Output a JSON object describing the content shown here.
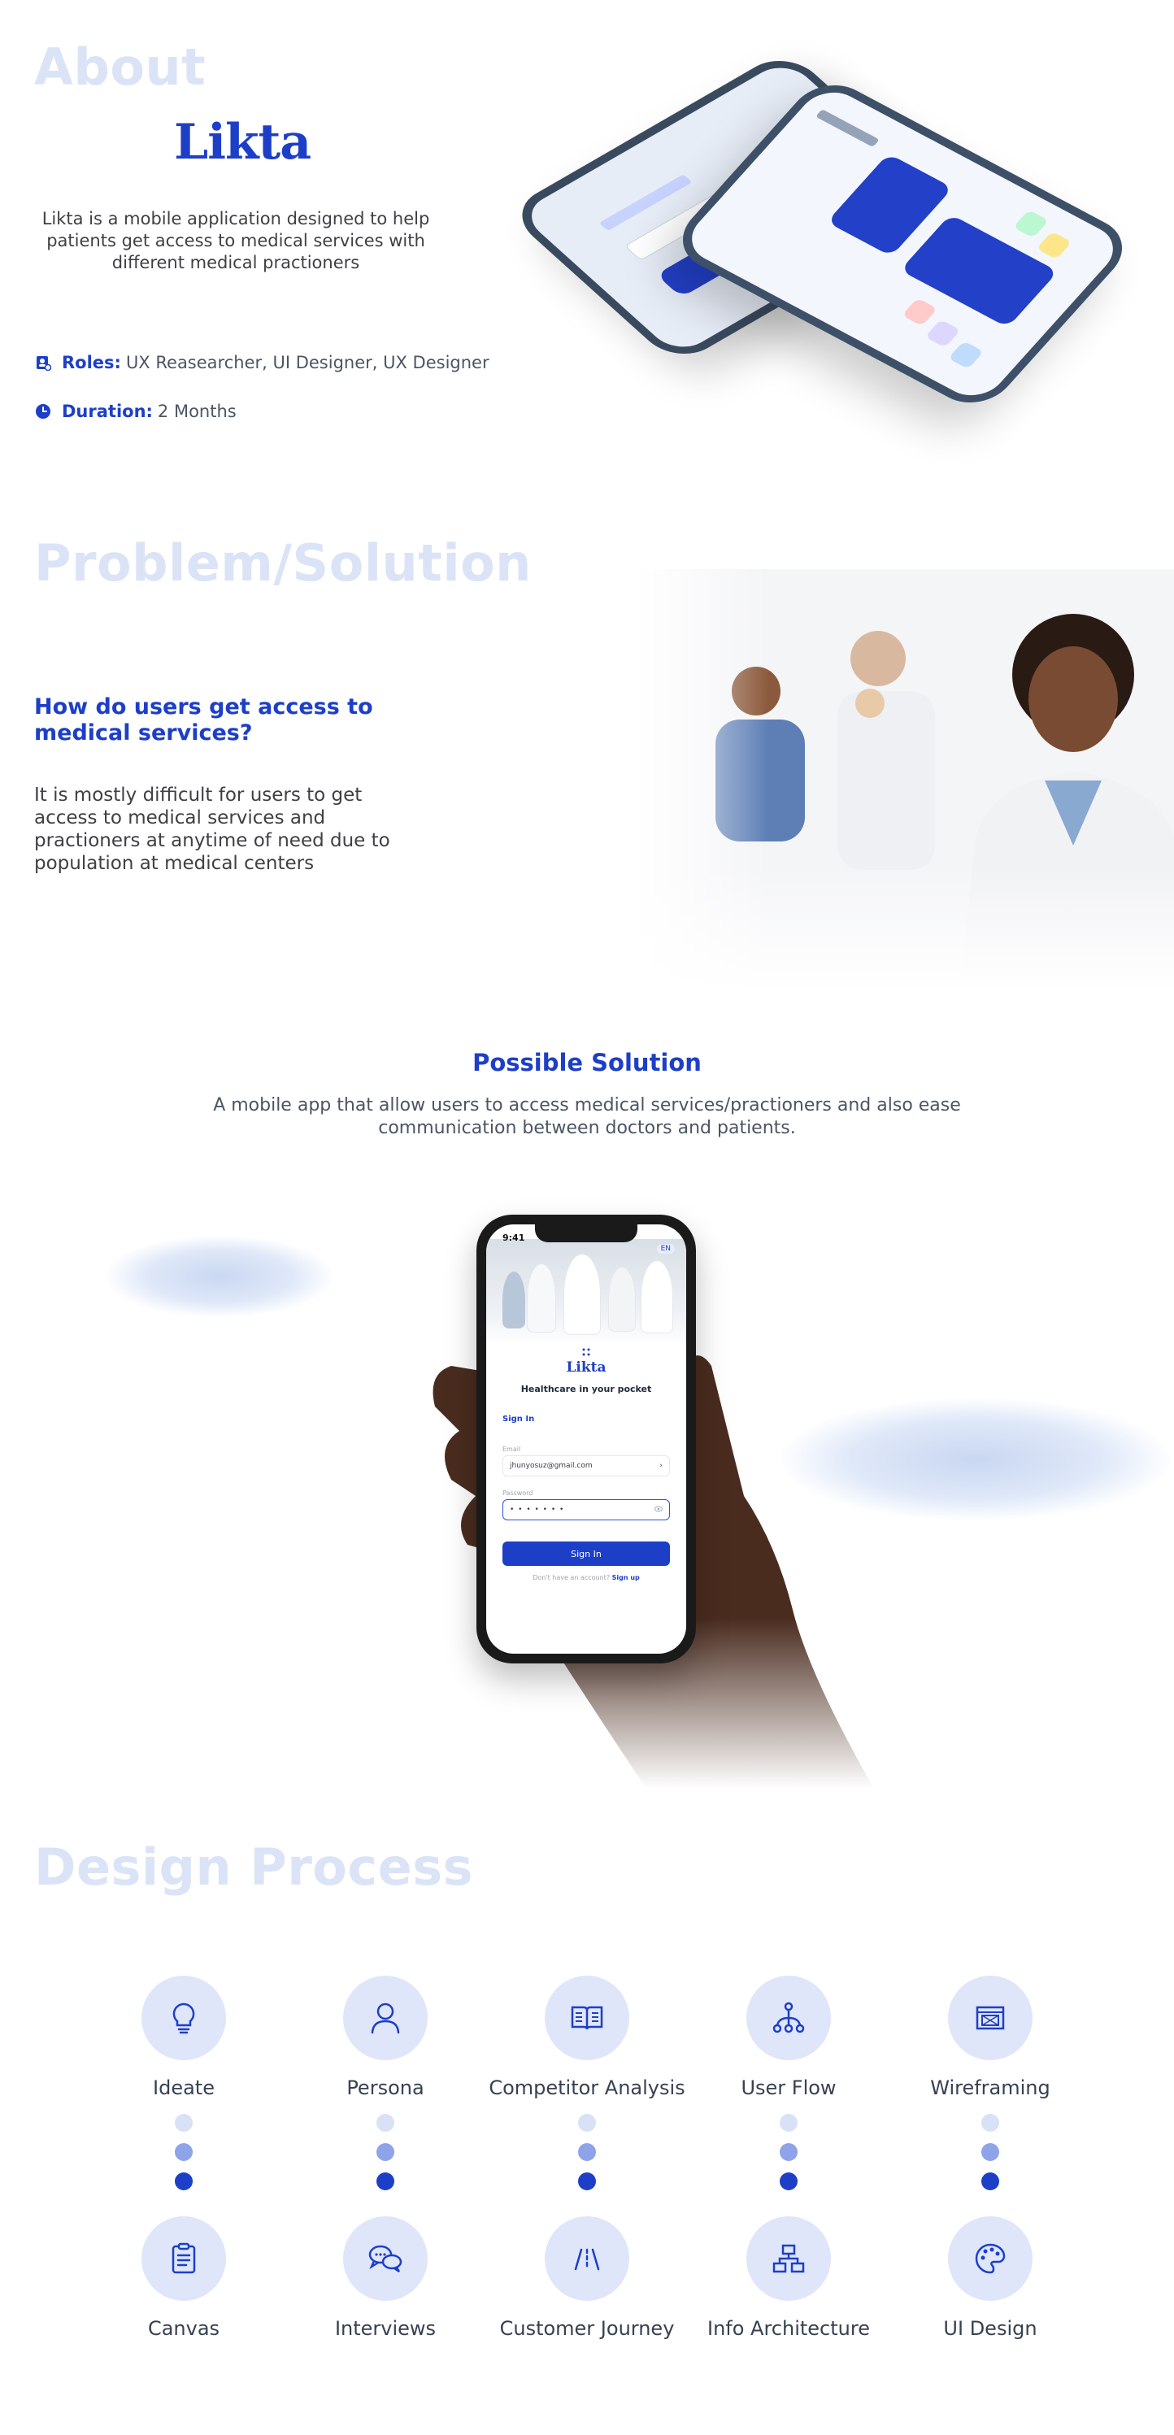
{
  "about": {
    "section_title": "About",
    "logo_text": "Likta",
    "description": "Likta is a mobile application designed to help patients get access to medical services with different medical practioners",
    "roles_label": "Roles:",
    "roles_value": "UX Reasearcher, UI Designer, UX Designer",
    "duration_label": "Duration:",
    "duration_value": "2 Months",
    "roles_icon": "badge-icon",
    "duration_icon": "clock-icon"
  },
  "problem": {
    "section_title": "Problem/Solution",
    "question": "How do users get access to medical services?",
    "description": "It is mostly difficult for users to get access to medical services and practioners at anytime of need due to population at medical centers"
  },
  "possible_solution": {
    "title": "Possible Solution",
    "description": "A mobile app that allow users to access medical services/practioners and also ease communication between doctors and patients."
  },
  "phone_screen": {
    "time": "9:41",
    "language": "EN",
    "logo_text": "Likta",
    "tagline": "Healthcare in your pocket",
    "signin_heading": "Sign In",
    "email_label": "Email",
    "email_value": "jhunyosuz@gmail.com",
    "password_label": "Password",
    "password_value": "• • • • • • •",
    "signin_button": "Sign In",
    "footer_text": "Don't have an account?",
    "footer_link": "Sign up"
  },
  "design_process": {
    "section_title": "Design Process",
    "steps_row1": [
      {
        "label": "Ideate",
        "icon": "lightbulb-icon"
      },
      {
        "label": "Persona",
        "icon": "user-icon"
      },
      {
        "label": "Competitor Analysis",
        "icon": "book-icon"
      },
      {
        "label": "User Flow",
        "icon": "flow-icon"
      },
      {
        "label": "Wireframing",
        "icon": "wireframe-icon"
      }
    ],
    "steps_row2": [
      {
        "label": "Canvas",
        "icon": "clipboard-icon"
      },
      {
        "label": "Interviews",
        "icon": "chat-icon"
      },
      {
        "label": "Customer Journey",
        "icon": "journey-icon"
      },
      {
        "label": "Info Architecture",
        "icon": "sitemap-icon"
      },
      {
        "label": "UI Design",
        "icon": "palette-icon"
      }
    ]
  },
  "colors": {
    "brand_blue": "#1d3fc8",
    "section_title": "#dbe3f7",
    "circle_bg": "#dfe6fa",
    "dot_light": "#d9e1f7",
    "dot_mid": "#8ea3e8"
  }
}
